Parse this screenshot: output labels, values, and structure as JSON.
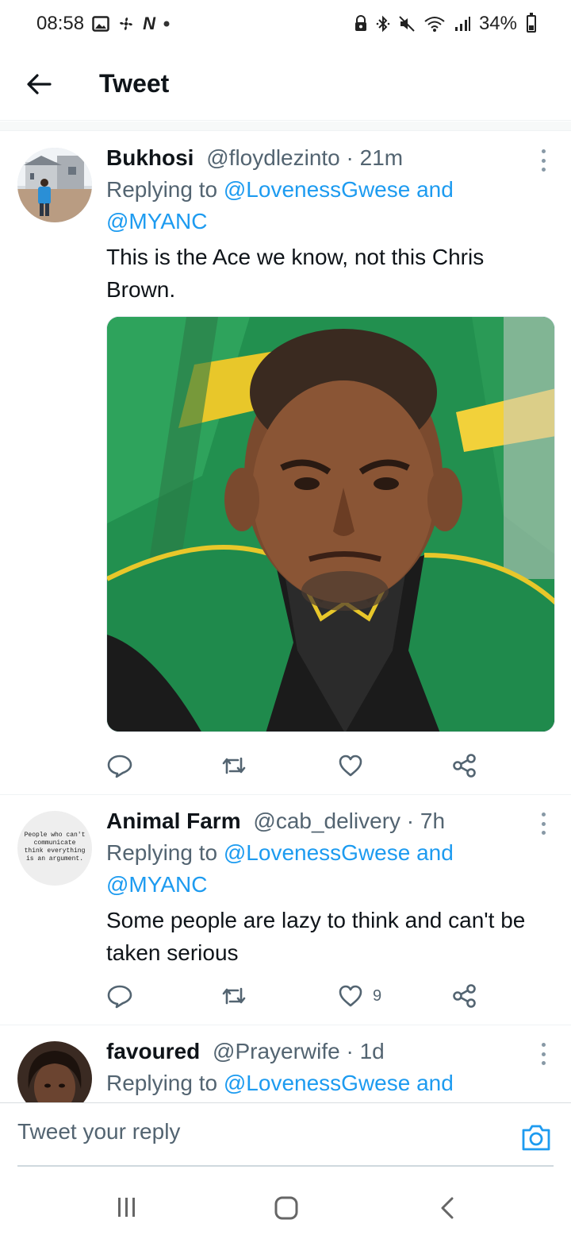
{
  "status_bar": {
    "time": "08:58",
    "left_icons": [
      "image-icon",
      "fan-icon",
      "n-icon",
      "dot-icon"
    ],
    "right_icons": [
      "lock-icon",
      "bluetooth-icon",
      "mute-icon",
      "wifi-icon",
      "signal-icon"
    ],
    "battery": "34%"
  },
  "header": {
    "title": "Tweet",
    "back_icon": "arrow-left-icon"
  },
  "tweets": [
    {
      "name": "Bukhosi",
      "handle": "@floydlezinto",
      "sep": " · ",
      "time": "21m",
      "replying_prefix": "Replying to ",
      "mention1": "@LovenessGwese",
      "and": " and",
      "mention2": "@MYANC",
      "text": "This is the Ace we know, not this Chris Brown.",
      "has_media": true,
      "likes": ""
    },
    {
      "name": "Animal Farm",
      "handle": "@cab_delivery",
      "sep": " · ",
      "time": "7h",
      "replying_prefix": "Replying to ",
      "mention1": "@LovenessGwese",
      "and": " and",
      "mention2": "@MYANC",
      "text": "Some people are lazy to think and can't be taken serious",
      "avatar_text": "People who can't communicate think everything is an argument.",
      "likes": "9"
    },
    {
      "name": "favoured",
      "handle": "@Prayerwife",
      "sep": " · ",
      "time": "1d",
      "replying_prefix": "Replying to ",
      "mention1": "@LovenessGwese",
      "and": " and"
    }
  ],
  "reply_bar": {
    "placeholder": "Tweet your reply"
  },
  "colors": {
    "accent": "#1d9bf0",
    "secondary_text": "#536471",
    "primary_text": "#0f1419"
  }
}
